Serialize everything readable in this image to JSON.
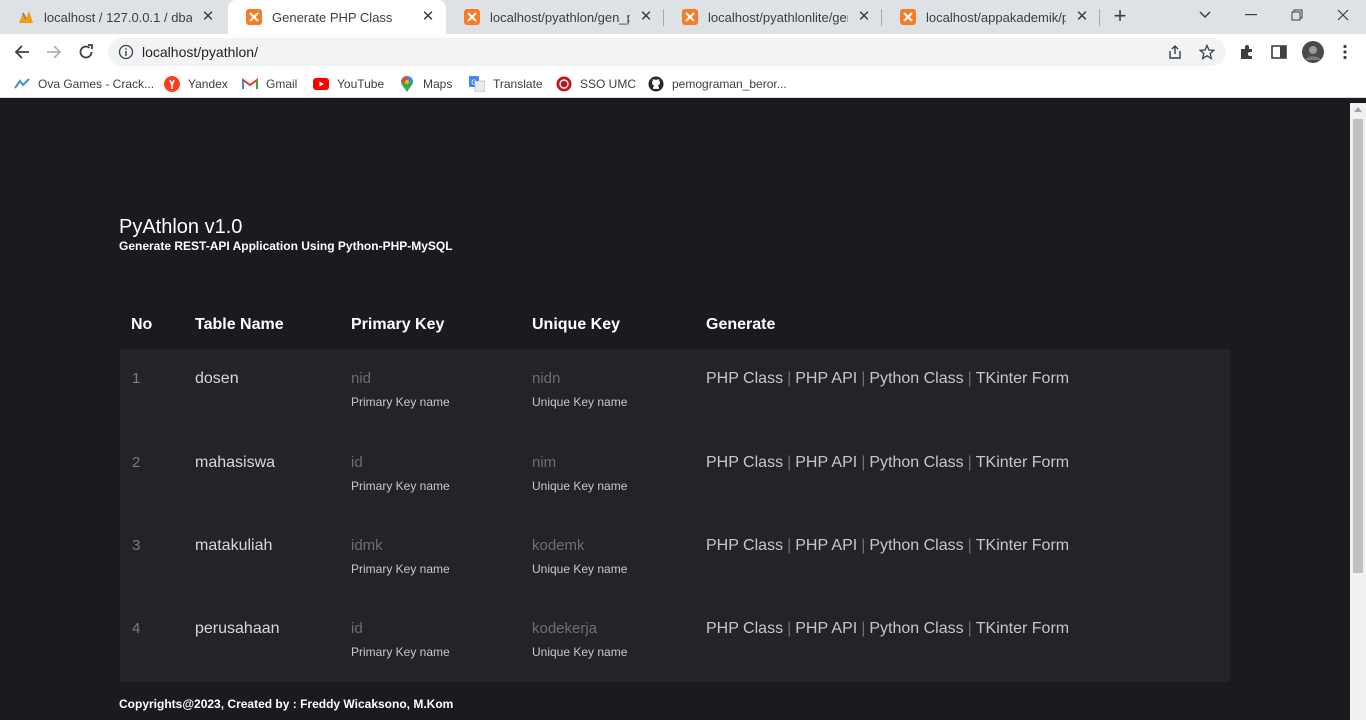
{
  "browser": {
    "tabs": [
      {
        "title": "localhost / 127.0.0.1 / dbapi",
        "icon": "phpmyadmin-icon",
        "active": false
      },
      {
        "title": "Generate PHP Class",
        "icon": "xampp-icon",
        "active": true
      },
      {
        "title": "localhost/pyathlon/gen_py_c",
        "icon": "xampp-icon",
        "active": false
      },
      {
        "title": "localhost/pyathlonlite/gen_p",
        "icon": "xampp-icon",
        "active": false
      },
      {
        "title": "localhost/appakademik/peru",
        "icon": "xampp-icon",
        "active": false
      }
    ],
    "new_tab": "+",
    "address": "localhost/pyathlon/",
    "bookmarks": [
      {
        "label": "Ova Games - Crack...",
        "icon": "ovagames-icon"
      },
      {
        "label": "Yandex",
        "icon": "yandex-icon"
      },
      {
        "label": "Gmail",
        "icon": "gmail-icon"
      },
      {
        "label": "YouTube",
        "icon": "youtube-icon"
      },
      {
        "label": "Maps",
        "icon": "maps-icon"
      },
      {
        "label": "Translate",
        "icon": "translate-icon"
      },
      {
        "label": "SSO UMC",
        "icon": "sso-icon"
      },
      {
        "label": "pemograman_beror...",
        "icon": "github-icon"
      }
    ]
  },
  "page": {
    "title": "PyAthlon v1.0",
    "subtitle": "Generate REST-API Application Using Python-PHP-MySQL",
    "table": {
      "headers": {
        "no": "No",
        "table_name": "Table Name",
        "primary_key": "Primary Key",
        "unique_key": "Unique Key",
        "generate": "Generate"
      },
      "rows": [
        {
          "no": "1",
          "name": "dosen",
          "pk": "nid",
          "pk_label": "Primary Key name",
          "uk": "nidn",
          "uk_label": "Unique Key name"
        },
        {
          "no": "2",
          "name": "mahasiswa",
          "pk": "id",
          "pk_label": "Primary Key name",
          "uk": "nim",
          "uk_label": "Unique Key name"
        },
        {
          "no": "3",
          "name": "matakuliah",
          "pk": "idmk",
          "pk_label": "Primary Key name",
          "uk": "kodemk",
          "uk_label": "Unique Key name"
        },
        {
          "no": "4",
          "name": "perusahaan",
          "pk": "id",
          "pk_label": "Primary Key name",
          "uk": "kodekerja",
          "uk_label": "Unique Key name"
        }
      ],
      "generate_links": {
        "php_class": "PHP Class",
        "php_api": "PHP API",
        "python_class": "Python Class",
        "tkinter_form": "TKinter Form",
        "separator": "|"
      }
    },
    "footer": "Copyrights@2023, Created by : Freddy Wicaksono, M.Kom"
  },
  "colors": {
    "page_bg": "#1b1b1f",
    "table_body_bg": "#242428",
    "tabstrip_bg": "#dee1e6",
    "xampp_orange": "#fb7a24"
  }
}
